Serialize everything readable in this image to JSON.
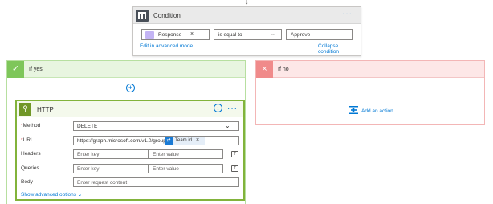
{
  "condition": {
    "title": "Condition",
    "menu": "···",
    "token_label": "Response",
    "token_icon": "variable-icon",
    "remove": "×",
    "operator": "is equal to",
    "value": "Approve",
    "edit_advanced": "Edit in advanced mode",
    "collapse": "Collapse condition"
  },
  "if_yes": {
    "title": "If yes",
    "check": "✓",
    "add_step": "+"
  },
  "http": {
    "title": "HTTP",
    "info": "i",
    "menu": "···",
    "method_label": "Method",
    "method_value": "DELETE",
    "uri_label": "URI",
    "uri_value": "https://graph.microsoft.com/v1.0/groups/",
    "uri_token": "Team id",
    "uri_token_remove": "×",
    "headers_label": "Headers",
    "queries_label": "Queries",
    "body_label": "Body",
    "key_placeholder": "Enter key",
    "value_placeholder": "Enter value",
    "body_placeholder": "Enter request content",
    "show_advanced": "Show advanced options"
  },
  "if_no": {
    "title": "If no",
    "cross": "×",
    "add_action": "Add an action"
  },
  "colors": {
    "accent": "#0078d4",
    "yes_green": "#7ec65a",
    "no_red": "#f08a8a",
    "http_green": "#709727"
  }
}
